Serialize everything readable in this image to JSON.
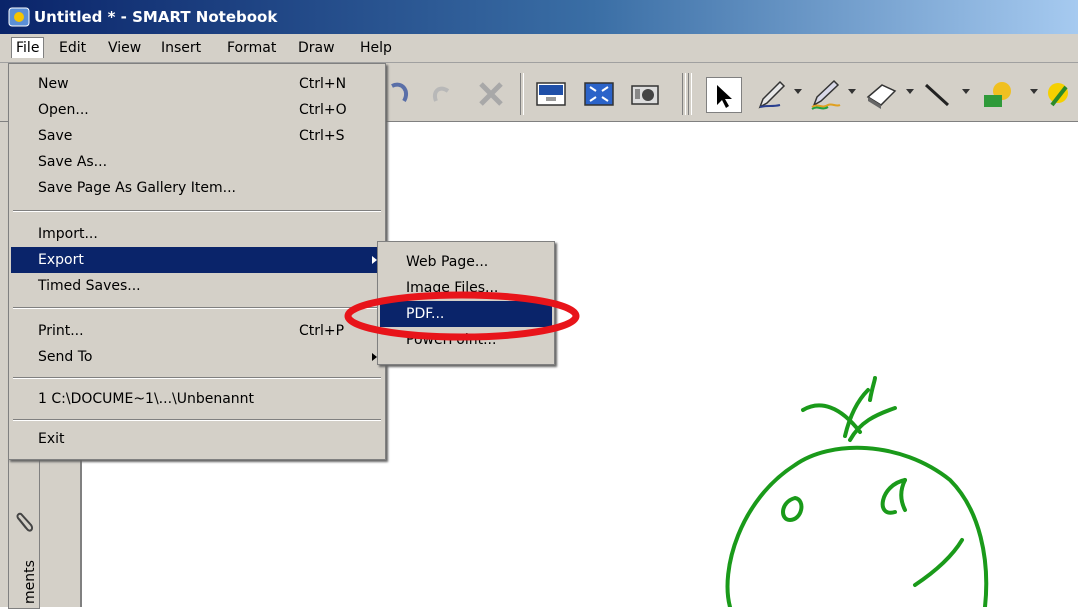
{
  "window": {
    "title": "Untitled * - SMART Notebook"
  },
  "menubar": {
    "items": [
      "File",
      "Edit",
      "View",
      "Insert",
      "Format",
      "Draw",
      "Help"
    ]
  },
  "file_menu": {
    "items": [
      {
        "label": "New",
        "shortcut": "Ctrl+N"
      },
      {
        "label": "Open...",
        "shortcut": "Ctrl+O"
      },
      {
        "label": "Save",
        "shortcut": "Ctrl+S"
      },
      {
        "label": "Save As...",
        "shortcut": ""
      },
      {
        "label": "Save Page As Gallery Item...",
        "shortcut": ""
      },
      {
        "label": "Import...",
        "shortcut": ""
      },
      {
        "label": "Export",
        "shortcut": ""
      },
      {
        "label": "Timed Saves...",
        "shortcut": ""
      },
      {
        "label": "Print...",
        "shortcut": "Ctrl+P"
      },
      {
        "label": "Send To",
        "shortcut": ""
      },
      {
        "label": "1 C:\\DOCUME~1\\...\\Unbenannt",
        "shortcut": ""
      },
      {
        "label": "Exit",
        "shortcut": ""
      }
    ]
  },
  "export_menu": {
    "items": [
      "Web Page...",
      "Image Files...",
      "PDF...",
      "PowerPoint..."
    ]
  },
  "side_panel": {
    "tab_label": "ments"
  },
  "colors": {
    "menu_highlight": "#0a246a",
    "annotation_red": "#e8141a",
    "doodle_green": "#1a9a1a"
  }
}
